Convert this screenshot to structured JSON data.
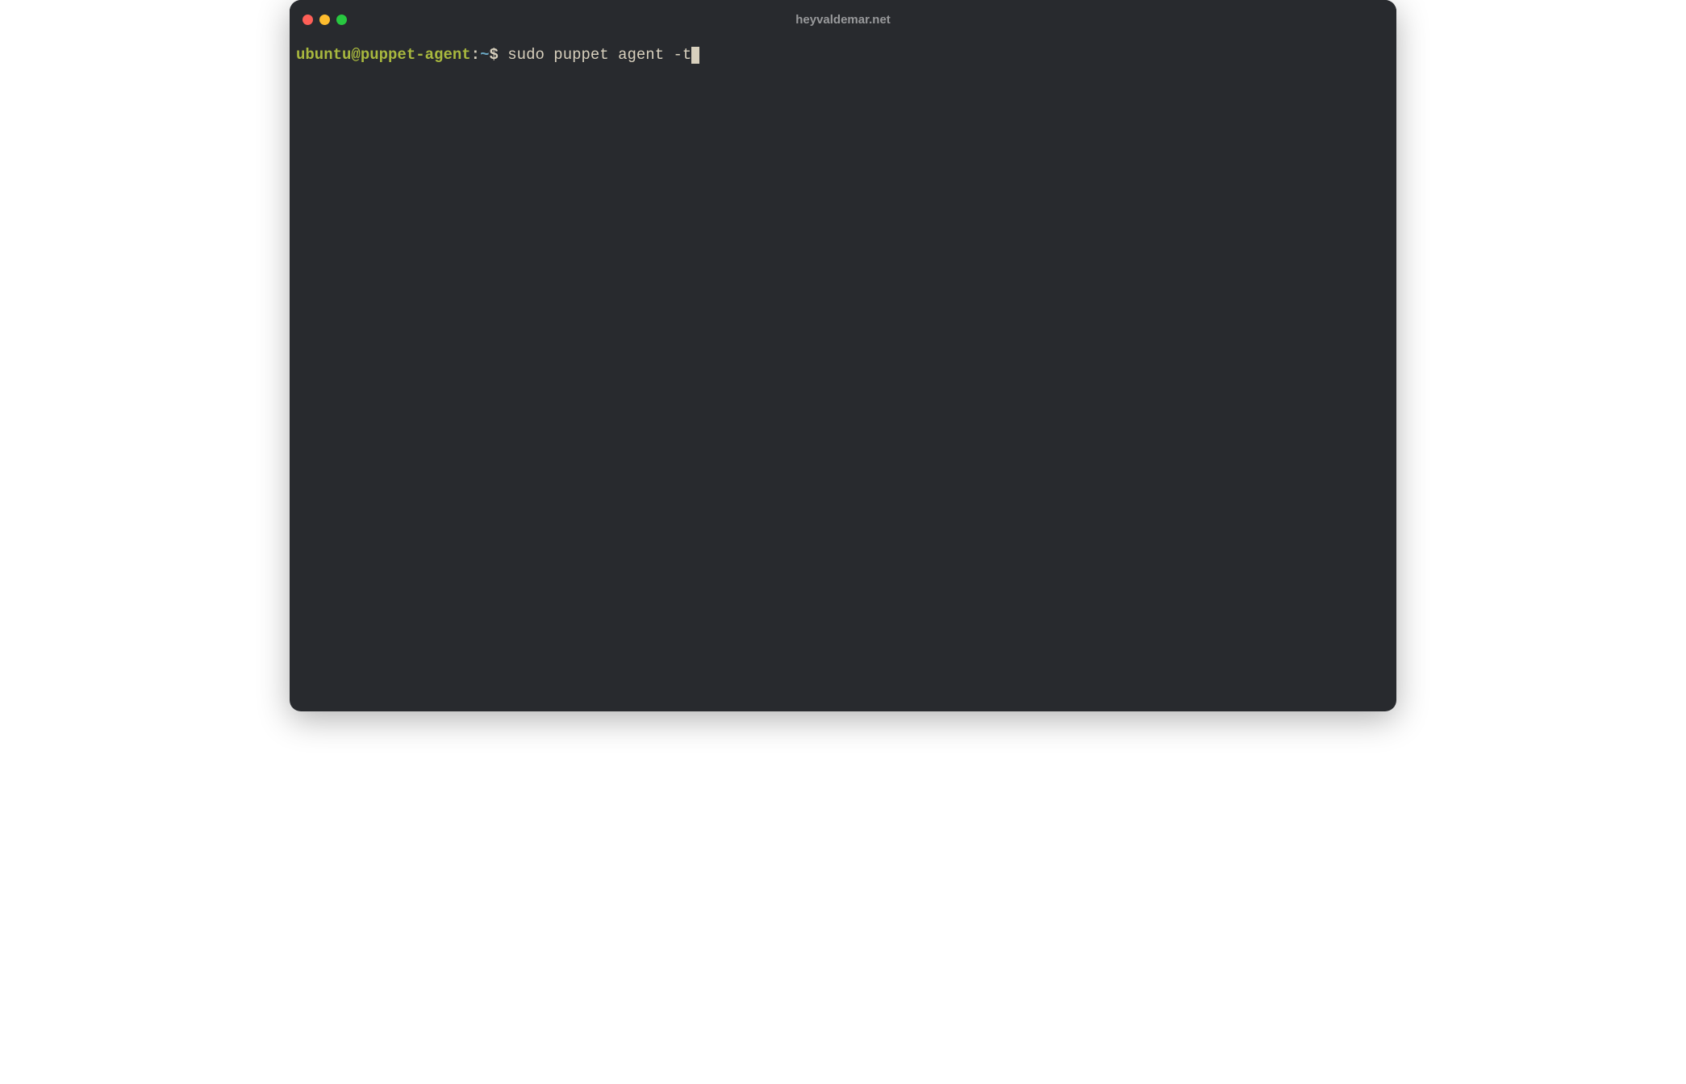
{
  "window": {
    "title": "heyvaldemar.net"
  },
  "prompt": {
    "user": "ubuntu",
    "host": "puppet-agent",
    "separator_uh": "@",
    "separator_hp": ":",
    "path": "~",
    "symbol": "$"
  },
  "terminal": {
    "command": "sudo puppet agent -t"
  },
  "colors": {
    "background": "#282a2e",
    "user_host": "#a8b83e",
    "path": "#6aa6c2",
    "text": "#d8d0bd",
    "close": "#ff5f57",
    "minimize": "#febc2e",
    "maximize": "#28c840"
  }
}
